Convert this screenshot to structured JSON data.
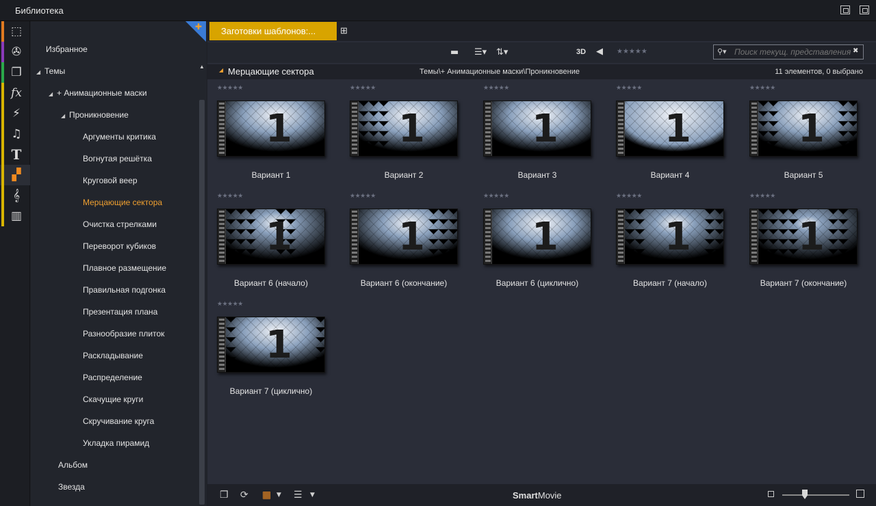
{
  "window": {
    "title": "Библиотека"
  },
  "rail": {
    "items": [
      {
        "icon": "box-icon",
        "glyph": "⬚",
        "color": "#e07a20"
      },
      {
        "icon": "film-reel-icon",
        "glyph": "✇",
        "color": "#8a3ab9"
      },
      {
        "icon": "projects-icon",
        "glyph": "❐",
        "color": "#2aa84a"
      },
      {
        "icon": "fx-icon",
        "glyph": "fx",
        "color": "#d8b400"
      },
      {
        "icon": "lightning-icon",
        "glyph": "⚡",
        "color": "#d8b400"
      },
      {
        "icon": "music-note-icon",
        "glyph": "♫",
        "color": "#d8b400"
      },
      {
        "icon": "title-t-icon",
        "glyph": "T",
        "color": "#d8b400"
      },
      {
        "icon": "montage-icon",
        "glyph": "▞",
        "color": "#d8b400"
      },
      {
        "icon": "treble-clef-icon",
        "glyph": "𝄞",
        "color": "#d8b400"
      },
      {
        "icon": "piano-icon",
        "glyph": "▥",
        "color": "#d8b400"
      }
    ]
  },
  "tree": {
    "items": [
      {
        "label": "Избранное",
        "level": 0,
        "tri": ""
      },
      {
        "label": "Темы",
        "level": 0,
        "tri": "◢"
      },
      {
        "label": "+ Анимационные маски",
        "level": 1,
        "tri": "◢"
      },
      {
        "label": "Проникновение",
        "level": 2,
        "tri": "◢"
      },
      {
        "label": "Аргументы критика",
        "level": 3,
        "tri": ""
      },
      {
        "label": "Вогнутая решётка",
        "level": 3,
        "tri": ""
      },
      {
        "label": "Круговой веер",
        "level": 3,
        "tri": ""
      },
      {
        "label": "Мерцающие сектора",
        "level": 3,
        "tri": "",
        "active": true
      },
      {
        "label": "Очистка стрелками",
        "level": 3,
        "tri": ""
      },
      {
        "label": "Переворот кубиков",
        "level": 3,
        "tri": ""
      },
      {
        "label": "Плавное размещение",
        "level": 3,
        "tri": ""
      },
      {
        "label": "Правильная подгонка",
        "level": 3,
        "tri": ""
      },
      {
        "label": "Презентация плана",
        "level": 3,
        "tri": ""
      },
      {
        "label": "Разнообразие плиток",
        "level": 3,
        "tri": ""
      },
      {
        "label": "Раскладывание",
        "level": 3,
        "tri": ""
      },
      {
        "label": "Распределение",
        "level": 3,
        "tri": ""
      },
      {
        "label": "Скачущие круги",
        "level": 3,
        "tri": ""
      },
      {
        "label": "Скручивание круга",
        "level": 3,
        "tri": ""
      },
      {
        "label": "Укладка пирамид",
        "level": 3,
        "tri": ""
      },
      {
        "label": "Альбом",
        "level": 1,
        "tri": ""
      },
      {
        "label": "Звезда",
        "level": 1,
        "tri": ""
      }
    ]
  },
  "tabs": {
    "active_label": "Заготовки шаблонов:..."
  },
  "toolbar": {
    "label_3d": "3D",
    "stars": "★★★★★",
    "search_placeholder": "Поиск текущ. представления"
  },
  "pathbar": {
    "section": "Мерцающие сектора",
    "path": "Темы\\+ Анимационные маски\\Проникновение",
    "count": "11 элементов, 0 выбрано"
  },
  "grid": {
    "stars": "★★★★★",
    "numeral": "1",
    "items": [
      {
        "label": "Вариант 1"
      },
      {
        "label": "Вариант 2"
      },
      {
        "label": "Вариант 3"
      },
      {
        "label": "Вариант 4"
      },
      {
        "label": "Вариант 5"
      },
      {
        "label": "Вариант 6 (начало)"
      },
      {
        "label": "Вариант 6 (окончание)"
      },
      {
        "label": "Вариант 6 (циклично)"
      },
      {
        "label": "Вариант 7 (начало)"
      },
      {
        "label": "Вариант 7 (окончание)"
      },
      {
        "label": "Вариант 7 (циклично)"
      }
    ]
  },
  "bottombar": {
    "brand_bold": "Smart",
    "brand_rest": "Movie"
  }
}
